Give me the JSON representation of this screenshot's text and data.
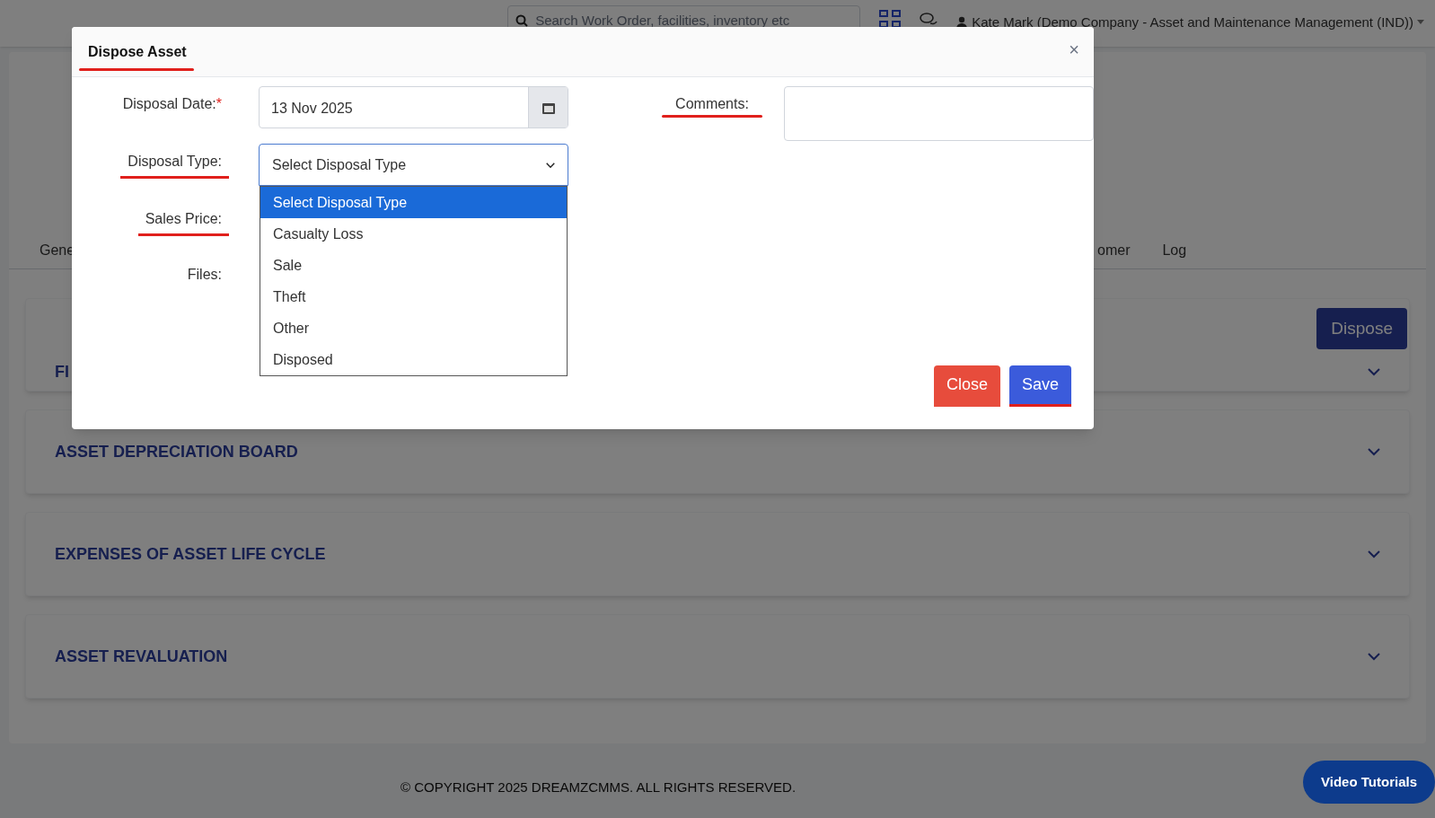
{
  "header": {
    "search_placeholder": "Search Work Order, facilities, inventory etc",
    "user": "Kate Mark (Demo Company - Asset and Maintenance Management (IND))"
  },
  "tabs_left": [
    {
      "label": "Gene"
    }
  ],
  "tabs_right": [
    {
      "label": "omer"
    },
    {
      "label": "Log"
    }
  ],
  "dispose_button": "Dispose",
  "sections": [
    {
      "title": "FI"
    },
    {
      "title": "ASSET DEPRECIATION BOARD"
    },
    {
      "title": "EXPENSES OF ASSET LIFE CYCLE"
    },
    {
      "title": "ASSET REVALUATION"
    }
  ],
  "footer": "© COPYRIGHT 2025 DREAMZCMMS. ALL RIGHTS RESERVED.",
  "video_button": "Video Tutorials",
  "modal": {
    "title": "Dispose Asset",
    "title_underlined": true,
    "close": "×",
    "disposal_date": {
      "label": "Disposal Date:",
      "required_mark": "*",
      "value": "13 Nov 2025",
      "underlined": false
    },
    "disposal_type": {
      "label": "Disposal Type:",
      "value": "Select Disposal Type",
      "underlined": true,
      "expanded": true,
      "options": [
        {
          "label": "Select Disposal Type",
          "selected": true
        },
        {
          "label": "Casualty Loss",
          "selected": false
        },
        {
          "label": "Sale",
          "selected": false
        },
        {
          "label": "Theft",
          "selected": false
        },
        {
          "label": "Other",
          "selected": false
        },
        {
          "label": "Disposed",
          "selected": false
        }
      ]
    },
    "sales_price": {
      "label": "Sales Price:",
      "underlined": true
    },
    "files": {
      "label": "Files:",
      "underlined": false
    },
    "comments": {
      "label": "Comments:",
      "underlined": true
    },
    "buttons": [
      {
        "label": "Close",
        "kind": "danger",
        "underlined": false
      },
      {
        "label": "Save",
        "kind": "primary",
        "underlined": true
      }
    ]
  }
}
